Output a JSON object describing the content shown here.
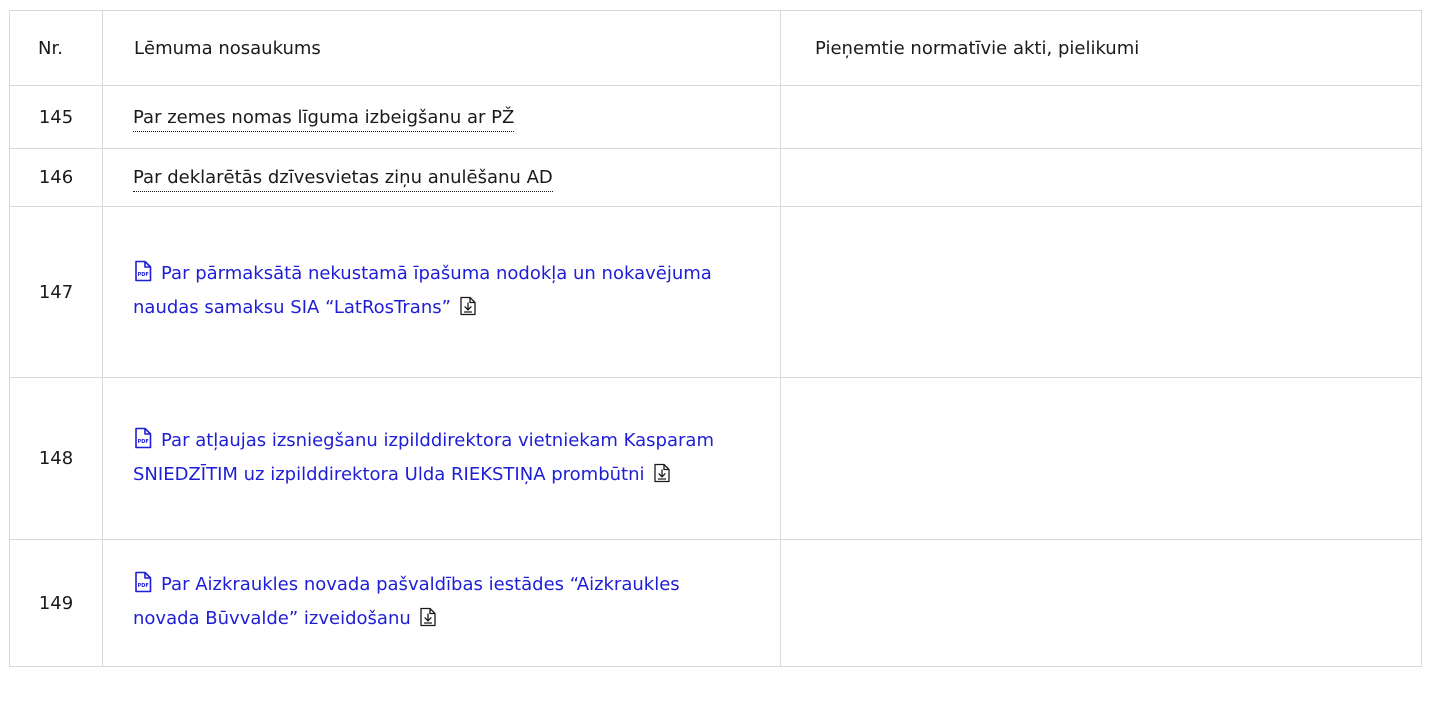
{
  "table": {
    "headers": {
      "nr": "Nr.",
      "name": "Lēmuma nosaukums",
      "acts": "Pieņemtie normatīvie akti, pielikumi"
    },
    "rows": [
      {
        "nr": "145",
        "title": "Par zemes nomas līguma izbeigšanu ar PŽ",
        "type": "plain"
      },
      {
        "nr": "146",
        "title": "Par deklarētās dzīvesvietas ziņu anulēšanu AD",
        "type": "plain"
      },
      {
        "nr": "147",
        "title": "Par pārmaksātā nekustamā īpašuma nodokļa un nokavējuma naudas samaksu SIA “LatRosTrans”",
        "type": "pdf"
      },
      {
        "nr": "148",
        "title": "Par atļaujas izsniegšanu izpilddirektora vietniekam Kasparam SNIEDZĪTIM uz izpilddirektora Ulda RIEKSTIŅA prombūtni",
        "type": "pdf"
      },
      {
        "nr": "149",
        "title": "Par Aizkraukles novada pašvaldības iestādes “Aizkraukles novada Būvvalde” izveidošanu",
        "type": "pdf"
      }
    ]
  },
  "icons": {
    "pdf": "pdf-file-icon",
    "download": "download-icon",
    "pdf_label": "PDF"
  },
  "colors": {
    "link": "#1e1ed6",
    "border": "#d9d9d9",
    "text": "#1a1a1a"
  }
}
